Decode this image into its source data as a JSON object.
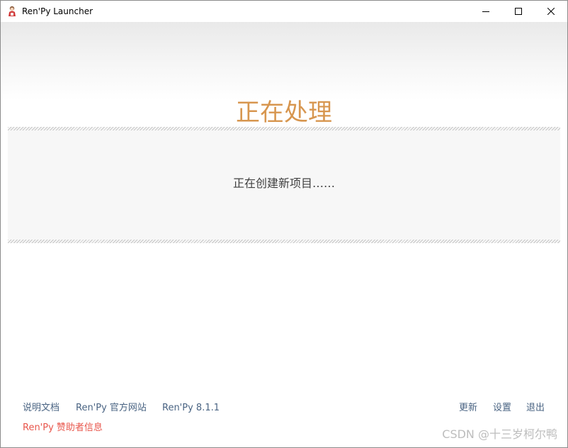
{
  "window": {
    "title": "Ren'Py Launcher",
    "controls": {
      "minimize_icon": "minimize-icon",
      "maximize_icon": "maximize-icon",
      "close_icon": "close-icon"
    }
  },
  "main": {
    "title": "正在处理",
    "message": "正在创建新项目……"
  },
  "footer": {
    "left_links": [
      "说明文档",
      "Ren'Py 官方网站",
      "Ren'Py 8.1.1"
    ],
    "sponsor_link": "Ren'Py 赞助者信息",
    "right_links": [
      "更新",
      "设置",
      "退出"
    ]
  },
  "watermark": "CSDN @十三岁柯尔鸭",
  "colors": {
    "title_accent": "#d7964f",
    "link": "#4a6483",
    "sponsor_link": "#e8564c"
  }
}
